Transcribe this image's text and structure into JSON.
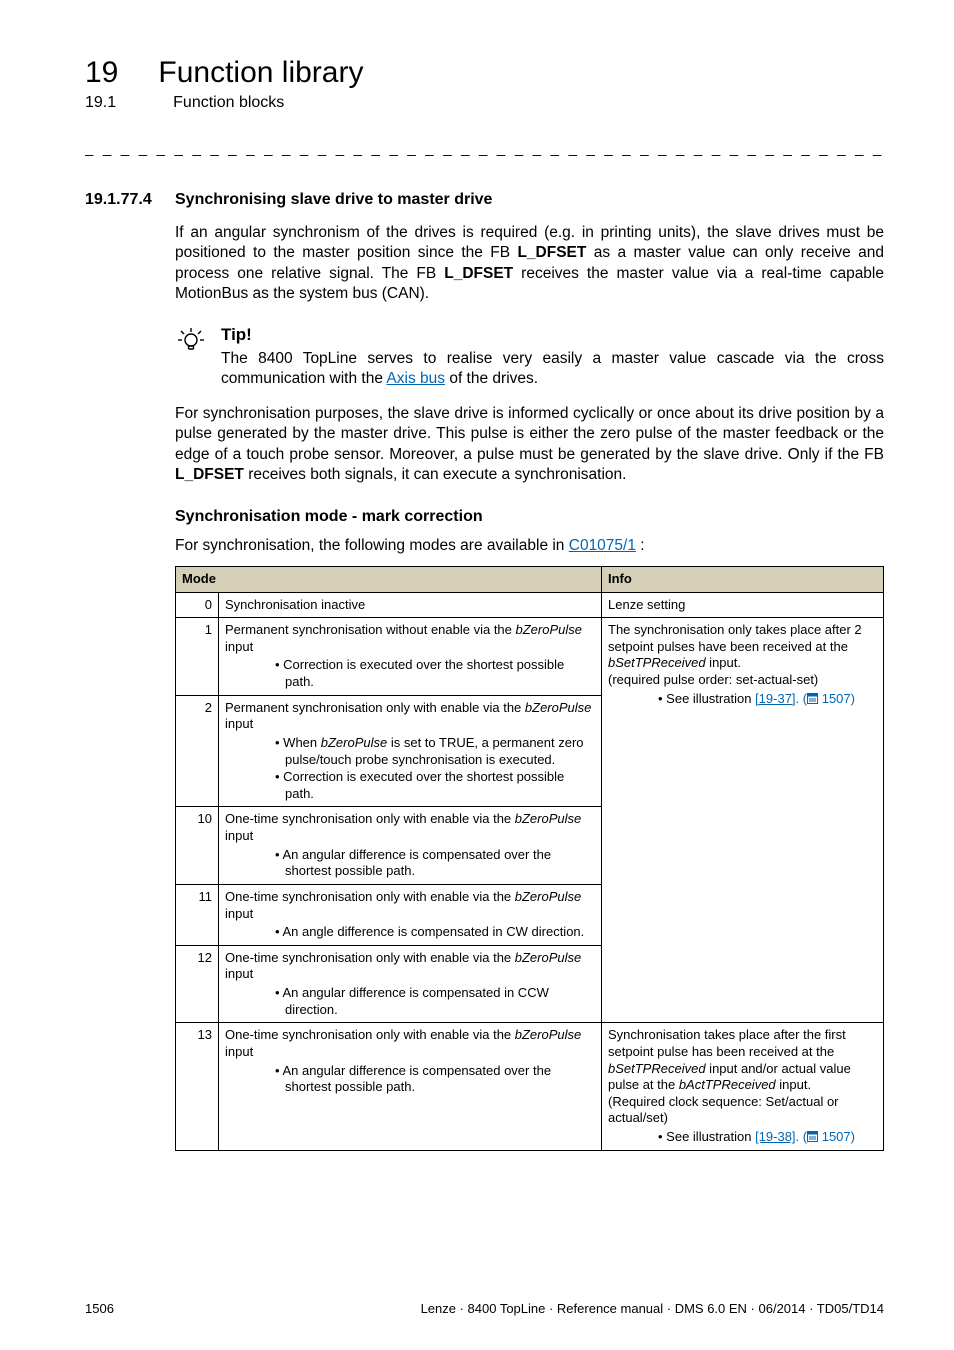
{
  "chapter": {
    "num": "19",
    "title": "Function library"
  },
  "sub": {
    "num": "19.1",
    "title": "Function blocks"
  },
  "divider": "_ _ _ _ _ _ _ _ _ _ _ _ _ _ _ _ _ _ _ _ _ _ _ _ _ _ _ _ _ _ _ _ _ _ _ _ _ _ _ _ _ _ _ _ _ _ _ _ _ _ _ _ _ _ _ _ _ _ _ _ _ _ _ _",
  "section": {
    "num": "19.1.77.4",
    "title": "Synchronising slave drive to master drive"
  },
  "para1_a": "If an angular synchronism of the drives is required (e.g. in printing units), the slave drives must be positioned to the master position since the FB ",
  "para1_fb1": "L_DFSET",
  "para1_b": " as a master value can only receive and process one relative signal. The FB ",
  "para1_fb2": "L_DFSET",
  "para1_c": " receives the master value via a real-time capable MotionBus as the system bus (CAN).",
  "tip": {
    "label": "Tip!",
    "text_a": "The 8400 TopLine serves to realise very easily a master value cascade via the cross communication with the ",
    "link": "Axis bus",
    "text_b": " of the drives."
  },
  "para2_a": "For synchronisation purposes, the slave drive is informed cyclically or once about its drive position by a pulse generated by the master drive. This pulse is either the zero pulse of the master feedback or the edge of a touch probe sensor. Moreover, a pulse must be generated by the slave drive. Only if the FB ",
  "para2_fb": "L_DFSET",
  "para2_b": " receives both signals, it can execute a synchronisation.",
  "subhead": "Synchronisation mode - mark correction",
  "para3_a": "For synchronisation, the following modes are available in ",
  "para3_link": "C01075/1",
  "para3_b": " :",
  "table": {
    "head_mode": "Mode",
    "head_info": "Info",
    "rows": [
      {
        "n": "0",
        "desc_main": "Synchronisation inactive",
        "bullets": []
      },
      {
        "n": "1",
        "desc_main_a": "Permanent synchronisation without enable via the ",
        "desc_main_i": "bZeroPulse",
        "desc_main_b": " input",
        "bullets": [
          "Correction is executed over the shortest possible path."
        ]
      },
      {
        "n": "2",
        "desc_main_a": "Permanent synchronisation only with enable via the ",
        "desc_main_i": "bZeroPulse",
        "desc_main_b": " input",
        "bullets": [
          "When bZeroPulse is set to TRUE, a permanent zero pulse/touch probe synchronisation is executed.",
          "Correction is executed over the shortest possible path."
        ]
      },
      {
        "n": "10",
        "desc_main_a": "One-time synchronisation only with enable via the ",
        "desc_main_i": "bZeroPulse",
        "desc_main_b": " input",
        "bullets": [
          "An angular difference is compensated over the shortest possible path."
        ]
      },
      {
        "n": "11",
        "desc_main_a": "One-time synchronisation only with enable via the ",
        "desc_main_i": "bZeroPulse",
        "desc_main_b": " input",
        "bullets": [
          "An angle difference is compensated in CW direction."
        ]
      },
      {
        "n": "12",
        "desc_main_a": "One-time synchronisation only with enable via the ",
        "desc_main_i": "bZeroPulse",
        "desc_main_b": " input",
        "bullets": [
          "An angular difference is compensated in CCW direction."
        ]
      },
      {
        "n": "13",
        "desc_main_a": "One-time synchronisation only with enable via the ",
        "desc_main_i": "bZeroPulse",
        "desc_main_b": " input",
        "bullets": [
          "An angular difference is compensated over the shortest possible path."
        ]
      }
    ],
    "info0": "Lenze setting",
    "info_block1_l1": "The synchronisation only takes place after 2 setpoint pulses have been received at the ",
    "info_block1_i1": "bSetTPReceived",
    "info_block1_l2": " input.",
    "info_block1_l3": "(required pulse order: set-actual-set)",
    "info_block1_see_a": "See illustration ",
    "info_block1_see_link": "[19-37]",
    "info_block1_see_b": ". (",
    "info_block1_see_page": " 1507)",
    "info_block2_l1": "Synchronisation takes place after the first setpoint pulse has been received at the ",
    "info_block2_i1": "bSetTPReceived",
    "info_block2_l2": " input and/or actual value pulse at the  ",
    "info_block2_i2": "bActTPReceived",
    "info_block2_l3": " input.",
    "info_block2_l4": "(Required clock sequence: Set/actual or actual/set)",
    "info_block2_see_a": "See illustration ",
    "info_block2_see_link": "[19-38]",
    "info_block2_see_b": ". (",
    "info_block2_see_page": " 1507)"
  },
  "footer": {
    "page": "1506",
    "right": "Lenze · 8400 TopLine · Reference manual · DMS 6.0 EN · 06/2014 · TD05/TD14"
  }
}
